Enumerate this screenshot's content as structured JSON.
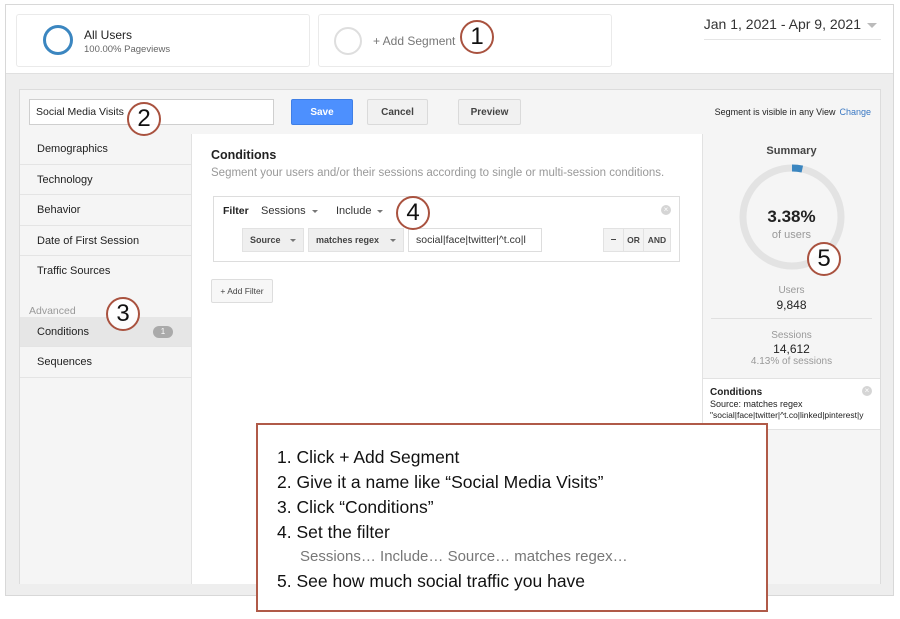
{
  "segment_bar": {
    "segments": [
      {
        "name": "All Users",
        "subtitle": "100.00% Pageviews",
        "ring_color": "#3b86c0"
      }
    ],
    "add_segment_label": "+ Add Segment",
    "date_range": "Jan 1, 2021 - Apr 9, 2021"
  },
  "editor": {
    "segment_name_value": "Social Media Visits",
    "save_label": "Save",
    "cancel_label": "Cancel",
    "preview_label": "Preview",
    "visibility_text": "Segment is visible in any View",
    "change_link": "Change"
  },
  "sidebar": {
    "items": [
      {
        "label": "Demographics"
      },
      {
        "label": "Technology"
      },
      {
        "label": "Behavior"
      },
      {
        "label": "Date of First Session"
      },
      {
        "label": "Traffic Sources"
      }
    ],
    "section_label": "Advanced",
    "advanced_items": [
      {
        "label": "Conditions",
        "badge": "1",
        "active": true
      },
      {
        "label": "Sequences"
      }
    ]
  },
  "conditions": {
    "title": "Conditions",
    "description": "Segment your users and/or their sessions according to single or multi-session conditions.",
    "filter": {
      "label": "Filter",
      "scope": "Sessions",
      "mode": "Include",
      "dimension": "Source",
      "operator": "matches regex",
      "value": "social|face|twitter|^t.co|l",
      "bool_buttons": [
        "–",
        "OR",
        "AND"
      ]
    },
    "add_filter_label": "+ Add Filter"
  },
  "summary": {
    "title": "Summary",
    "percent_of_users": "3.38%",
    "percent_fraction": 0.0338,
    "percent_label": "of users",
    "users_label": "Users",
    "users_value": "9,848",
    "sessions_label": "Sessions",
    "sessions_value": "14,612",
    "sessions_pct": "4.13% of sessions",
    "conditions_title": "Conditions",
    "conditions_line1": "Source: matches regex",
    "conditions_line2": "\"social|face|twitter|^t.co|linked|pinterest|y",
    "accent_color": "#3b86c0"
  },
  "callouts": [
    "1",
    "2",
    "3",
    "4",
    "5"
  ],
  "instructions": {
    "steps": [
      "1. Click + Add Segment",
      "2. Give it a name like “Social Media Visits”",
      "3. Click “Conditions”",
      "4. Set the filter",
      "5. See how much social traffic you have"
    ],
    "step4_detail": "Sessions… Include… Source… matches regex…",
    "border_color": "#b05a48"
  }
}
